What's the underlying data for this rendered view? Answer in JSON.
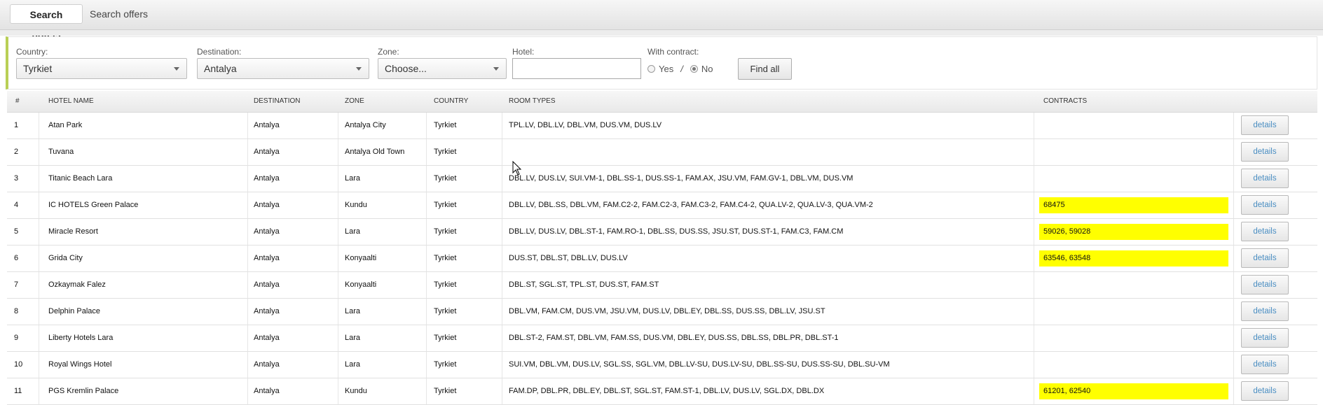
{
  "tabs": [
    {
      "label": "Search hotels",
      "active": true
    },
    {
      "label": "Search offers",
      "active": false
    }
  ],
  "filters": {
    "country": {
      "label": "Country:",
      "value": "Tyrkiet"
    },
    "destination": {
      "label": "Destination:",
      "value": "Antalya"
    },
    "zone": {
      "label": "Zone:",
      "value": "Choose..."
    },
    "hotel": {
      "label": "Hotel:",
      "value": ""
    },
    "with_contract": {
      "label": "With contract:",
      "yes": "Yes",
      "separator": "/",
      "no": "No",
      "selected": "No"
    },
    "find_all": "Find all"
  },
  "table": {
    "headers": [
      "#",
      "HOTEL NAME",
      "DESTINATION",
      "ZONE",
      "COUNTRY",
      "ROOM TYPES",
      "CONTRACTS"
    ],
    "details_label": "details",
    "highlight_color": "#ffff00",
    "rows": [
      {
        "num": "1",
        "name": "Atan Park",
        "destination": "Antalya",
        "zone": "Antalya City",
        "country": "Tyrkiet",
        "rooms": "TPL.LV, DBL.LV, DBL.VM, DUS.VM, DUS.LV",
        "contracts": ""
      },
      {
        "num": "2",
        "name": "Tuvana",
        "destination": "Antalya",
        "zone": "Antalya Old Town",
        "country": "Tyrkiet",
        "rooms": "",
        "contracts": ""
      },
      {
        "num": "3",
        "name": "Titanic Beach Lara",
        "destination": "Antalya",
        "zone": "Lara",
        "country": "Tyrkiet",
        "rooms": "DBL.LV, DUS.LV, SUI.VM-1, DBL.SS-1, DUS.SS-1, FAM.AX, JSU.VM, FAM.GV-1, DBL.VM, DUS.VM",
        "contracts": ""
      },
      {
        "num": "4",
        "name": "IC HOTELS Green Palace",
        "destination": "Antalya",
        "zone": "Kundu",
        "country": "Tyrkiet",
        "rooms": "DBL.LV, DBL.SS, DBL.VM, FAM.C2-2, FAM.C2-3, FAM.C3-2, FAM.C4-2, QUA.LV-2, QUA.LV-3, QUA.VM-2",
        "contracts": "68475"
      },
      {
        "num": "5",
        "name": "Miracle Resort",
        "destination": "Antalya",
        "zone": "Lara",
        "country": "Tyrkiet",
        "rooms": "DBL.LV, DUS.LV, DBL.ST-1, FAM.RO-1, DBL.SS, DUS.SS, JSU.ST, DUS.ST-1, FAM.C3, FAM.CM",
        "contracts": "59026, 59028"
      },
      {
        "num": "6",
        "name": "Grida City",
        "destination": "Antalya",
        "zone": "Konyaalti",
        "country": "Tyrkiet",
        "rooms": "DUS.ST, DBL.ST, DBL.LV, DUS.LV",
        "contracts": "63546, 63548"
      },
      {
        "num": "7",
        "name": "Ozkaymak Falez",
        "destination": "Antalya",
        "zone": "Konyaalti",
        "country": "Tyrkiet",
        "rooms": "DBL.ST, SGL.ST, TPL.ST, DUS.ST, FAM.ST",
        "contracts": ""
      },
      {
        "num": "8",
        "name": "Delphin Palace",
        "destination": "Antalya",
        "zone": "Lara",
        "country": "Tyrkiet",
        "rooms": "DBL.VM, FAM.CM, DUS.VM, JSU.VM, DUS.LV, DBL.EY, DBL.SS, DUS.SS, DBL.LV, JSU.ST",
        "contracts": ""
      },
      {
        "num": "9",
        "name": "Liberty Hotels Lara",
        "destination": "Antalya",
        "zone": "Lara",
        "country": "Tyrkiet",
        "rooms": "DBL.ST-2, FAM.ST, DBL.VM, FAM.SS, DUS.VM, DBL.EY, DUS.SS, DBL.SS, DBL.PR, DBL.ST-1",
        "contracts": ""
      },
      {
        "num": "10",
        "name": "Royal Wings Hotel",
        "destination": "Antalya",
        "zone": "Lara",
        "country": "Tyrkiet",
        "rooms": "SUI.VM, DBL.VM, DUS.LV, SGL.SS, SGL.VM, DBL.LV-SU, DUS.LV-SU, DBL.SS-SU, DUS.SS-SU, DBL.SU-VM",
        "contracts": ""
      },
      {
        "num": "11",
        "name": "PGS Kremlin Palace",
        "destination": "Antalya",
        "zone": "Kundu",
        "country": "Tyrkiet",
        "rooms": "FAM.DP, DBL.PR, DBL.EY, DBL.ST, SGL.ST, FAM.ST-1, DBL.LV, DUS.LV, SGL.DX, DBL.DX",
        "contracts": "61201, 62540"
      }
    ]
  }
}
